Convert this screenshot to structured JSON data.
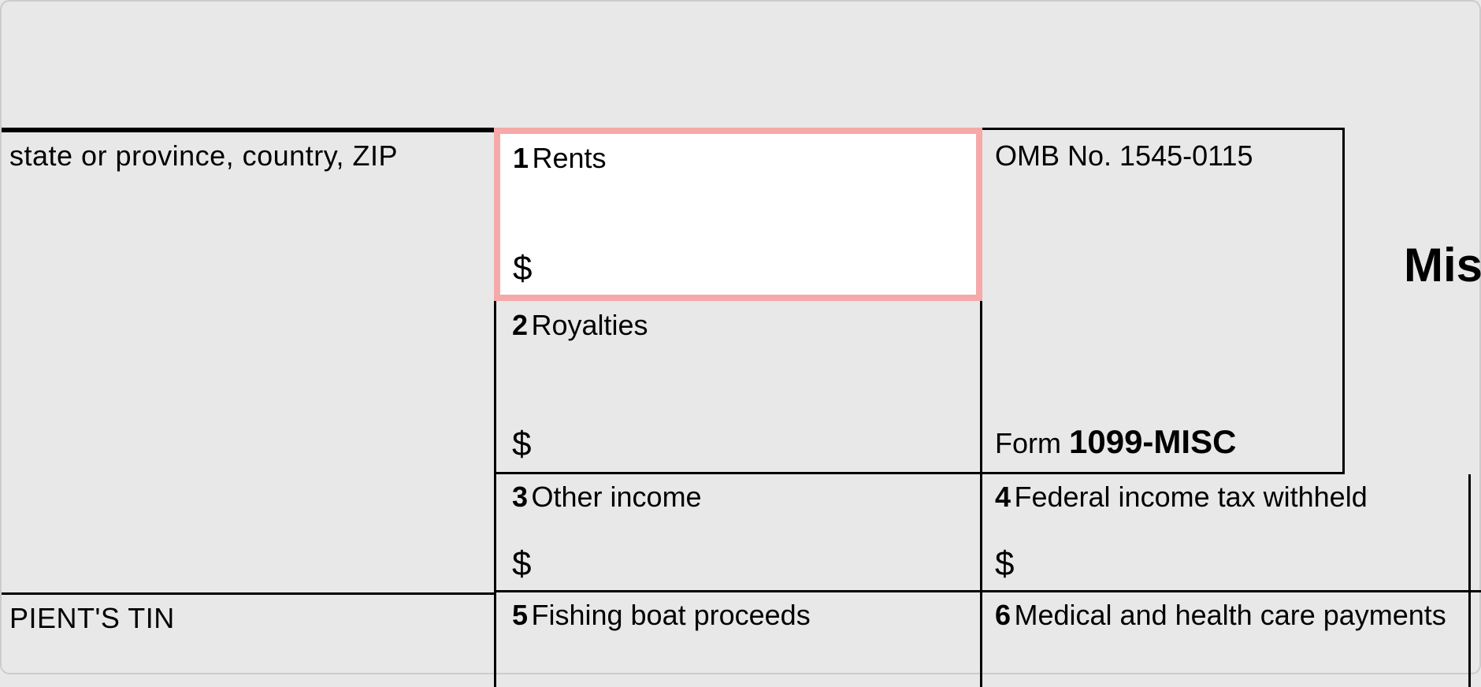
{
  "payer_address_fragment": "state or province, country, ZIP",
  "boxes": {
    "box1": {
      "number": "1",
      "label": "Rents",
      "currency": "$"
    },
    "box2": {
      "number": "2",
      "label": "Royalties",
      "currency": "$"
    },
    "box3": {
      "number": "3",
      "label": "Other income",
      "currency": "$"
    },
    "box4": {
      "number": "4",
      "label": "Federal income tax withheld",
      "currency": "$"
    },
    "box5": {
      "number": "5",
      "label": "Fishing boat proceeds"
    },
    "box6": {
      "number": "6",
      "label": "Medical and health care payments"
    }
  },
  "omb": "OMB No. 1545-0115",
  "form_prefix": "Form ",
  "form_name": "1099-MISC",
  "title_fragment": "Mis",
  "tin_fragment": "PIENT'S TIN"
}
